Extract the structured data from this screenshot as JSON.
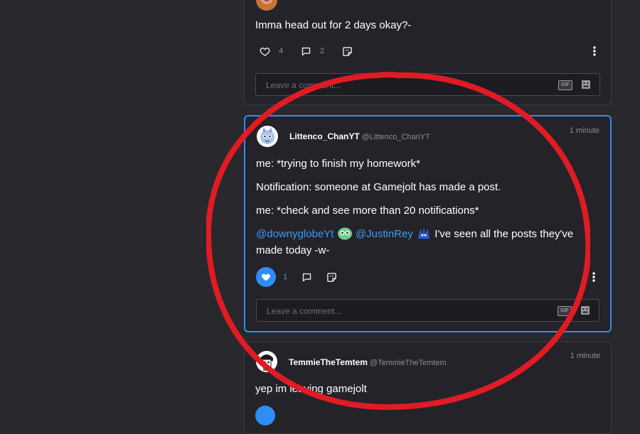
{
  "posts": [
    {
      "text": "Imma head out for 2 days okay?-",
      "like_count": "4",
      "comment_count": "2",
      "comment_placeholder": "Leave a comment..."
    },
    {
      "username": "Littenco_ChanYT",
      "handle": "@Littenco_ChanYT",
      "time": "1 minute",
      "para1": "me: *trying to finish my homework*",
      "para2": "Notification: someone at Gamejolt has made a post.",
      "para3": "me: *check and see more than 20 notifications*",
      "mention1": "@downyglobeYt",
      "mention2": "@JustinRey",
      "para4_rest": "I've seen all the posts they've made today -w-",
      "like_count": "1",
      "comment_placeholder": "Leave a comment..."
    },
    {
      "username": "TemmieTheTemtem",
      "handle": "@TemmieTheTemtem",
      "time": "1 minute",
      "text": "yep im leaving gamejolt"
    }
  ],
  "gif_label": "GIF",
  "icons": {
    "like": "heart-icon",
    "comment": "comment-icon",
    "sticker": "sticker-icon",
    "more": "more-vertical-icon",
    "gif": "gif-icon"
  },
  "colors": {
    "background": "#29282d",
    "card": "#24232a",
    "accent": "#2e8ef5",
    "annotation": "#e01b24"
  }
}
